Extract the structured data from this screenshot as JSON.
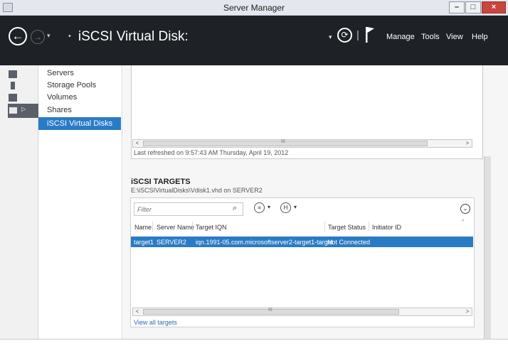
{
  "window": {
    "title": "Server Manager",
    "minimize_label": "–",
    "maximize_label": "□",
    "close_label": "×"
  },
  "header": {
    "back_glyph": "←",
    "forward_glyph": "→",
    "dropdown_glyph": "▾",
    "breadcrumb_sep": "•",
    "breadcrumb": "iSCSI Virtual Disk:",
    "refresh_glyph": "⟳",
    "pipe": "|",
    "menu": [
      "Manage",
      "Tools",
      "View",
      "Help"
    ]
  },
  "subnav": {
    "items": [
      "Servers",
      "Storage Pools",
      "Volumes",
      "Shares",
      "iSCSI Virtual Disks"
    ],
    "selected_index": 4
  },
  "top_panel": {
    "last_refreshed": "Last refreshed on 9:57:43 AM Thursday, April 19, 2012"
  },
  "scroll": {
    "left_arrow": "<",
    "right_arrow": ">",
    "grip": "III"
  },
  "targets": {
    "title": "iSCSI TARGETS",
    "subtitle": "E:\\iSCSIVirtualDisks\\Vdisk1.vhd on SERVER2",
    "filter_placeholder": "Filter",
    "search_glyph": "⌕",
    "list_glyph": "≡",
    "save_glyph": "H",
    "dropdown_glyph": "▾",
    "expand_glyph": "⌄",
    "sort_caret": "^",
    "columns": [
      "Name",
      "Server Name",
      "Target IQN",
      "Target Status",
      "Initiator ID"
    ],
    "rows": [
      {
        "name": "target1",
        "server": "SERVER2",
        "iqn": "iqn.1991-05.com.microsoftserver2-target1-target",
        "status": "Not Connected",
        "initiator": ""
      }
    ],
    "view_all": "View all targets"
  },
  "colors": {
    "header_bg": "#1e2125",
    "selection": "#2a7bc6",
    "link": "#2a6db0"
  }
}
